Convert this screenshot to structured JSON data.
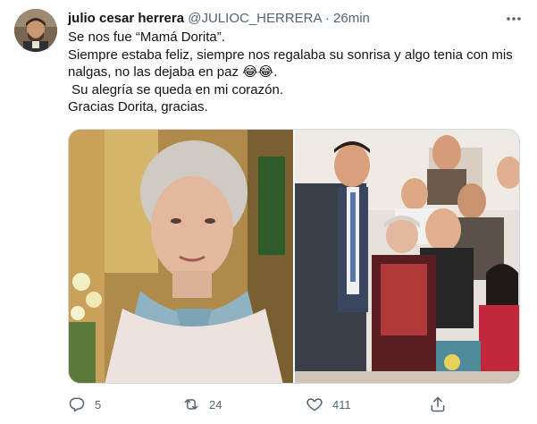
{
  "tweet": {
    "author_name": "julio cesar herrera",
    "author_handle": "@JULIOC_HERRERA",
    "separator": "·",
    "time": "26min",
    "lines": [
      "Se nos fue “Mamá Dorita”.",
      "Siempre estaba feliz, siempre nos regalaba su sonrisa y algo tenia con mis",
      "nalgas, no las dejaba en paz 😂😂.",
      " Su alegría se queda en mi corazón.",
      "Gracias Dorita, gracias."
    ]
  },
  "actions": {
    "reply_count": "5",
    "retweet_count": "24",
    "like_count": "411"
  },
  "icons": {
    "more": "more-icon",
    "reply": "reply-icon",
    "retweet": "retweet-icon",
    "like": "like-icon",
    "share": "share-icon"
  },
  "colors": {
    "text": "#0f1419",
    "secondary": "#536471",
    "border": "#cfd9de"
  }
}
